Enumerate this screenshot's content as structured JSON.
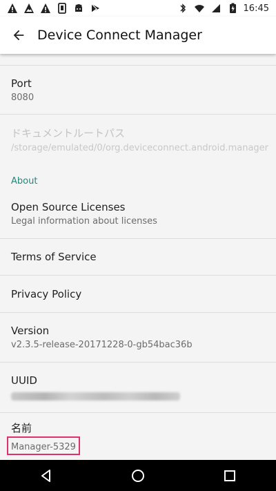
{
  "status_bar": {
    "time": "16:45",
    "left_icons": [
      "warning-icon",
      "photo-warning-icon",
      "warning-icon",
      "sim-icon",
      "android-icon",
      "play-store-icon"
    ],
    "right_icons": [
      "bluetooth-icon",
      "wifi-icon",
      "signal-icon",
      "battery-charging-icon"
    ]
  },
  "app_bar": {
    "title": "Device Connect Manager",
    "back_icon": "arrow-back-icon"
  },
  "prefs": {
    "port": {
      "title": "Port",
      "summary": "8080"
    },
    "doc_root": {
      "title": "ドキュメントルートパス",
      "summary": "/storage/emulated/0/org.deviceconnect.android.manager"
    },
    "about_header": "About",
    "licenses": {
      "title": "Open Source Licenses",
      "summary": "Legal information about licenses"
    },
    "terms": {
      "title": "Terms of Service"
    },
    "privacy": {
      "title": "Privacy Policy"
    },
    "version": {
      "title": "Version",
      "summary": "v2.3.5-release-20171228-0-gb54bac36b"
    },
    "uuid": {
      "title": "UUID"
    },
    "name": {
      "title": "名前",
      "summary": "Manager-5329"
    }
  },
  "colors": {
    "accent": "#1e8a7a",
    "highlight": "#e0306a"
  }
}
